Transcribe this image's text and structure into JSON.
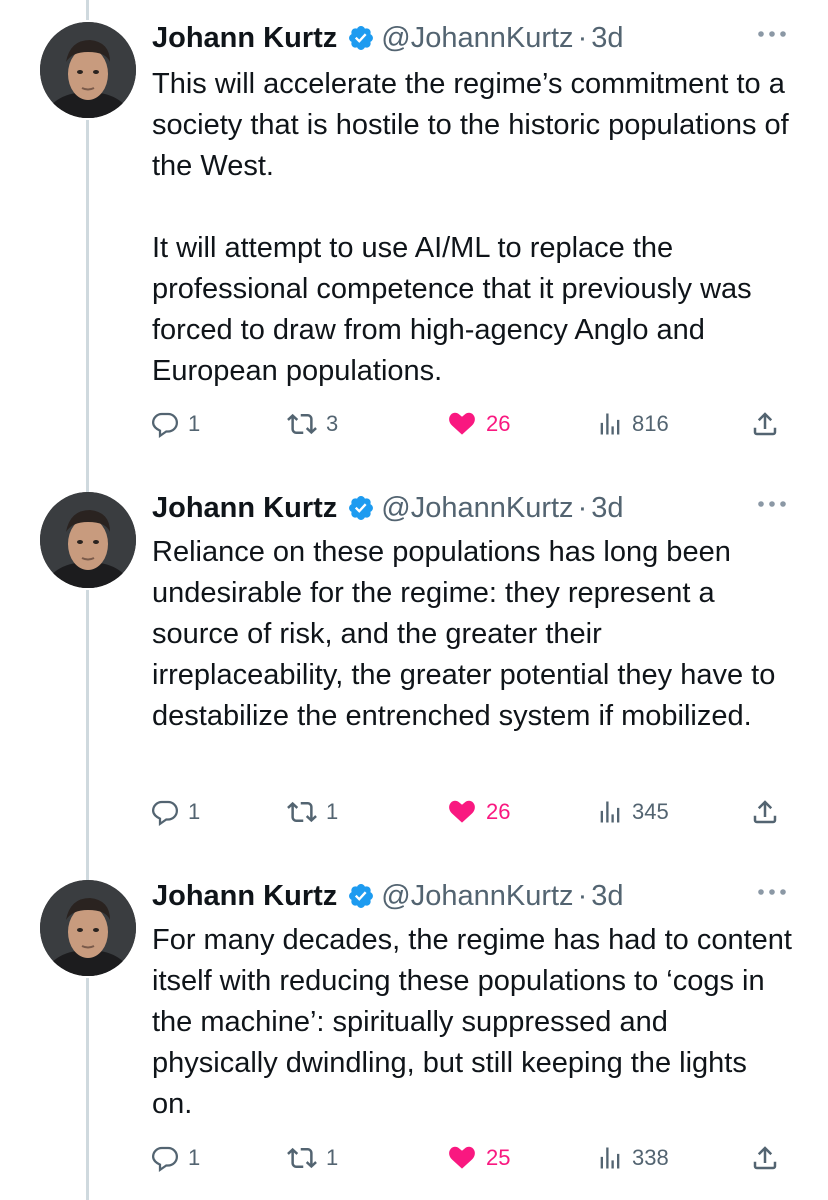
{
  "colors": {
    "text": "#0f1419",
    "secondary": "#536471",
    "verified": "#1d9bf0",
    "like": "#f91880",
    "thread_line": "#cfd9de"
  },
  "tweets": [
    {
      "author_name": "Johann Kurtz",
      "handle": "@JohannKurtz",
      "separator": "·",
      "time": "3d",
      "paragraphs": [
        "This will accelerate the regime’s commitment to a society that is hostile to the historic populations of the West.",
        "It will attempt to use AI/ML to replace the professional competence that it previously was forced to draw from high-agency Anglo and European populations."
      ],
      "replies": "1",
      "retweets": "3",
      "likes": "26",
      "views": "816",
      "liked": true
    },
    {
      "author_name": "Johann Kurtz",
      "handle": "@JohannKurtz",
      "separator": "·",
      "time": "3d",
      "paragraphs": [
        "Reliance on these populations has long been undesirable for the regime: they represent a source of risk, and the greater their irreplaceability, the greater potential they have to destabilize the entrenched system if mobilized."
      ],
      "replies": "1",
      "retweets": "1",
      "likes": "26",
      "views": "345",
      "liked": true
    },
    {
      "author_name": "Johann Kurtz",
      "handle": "@JohannKurtz",
      "separator": "·",
      "time": "3d",
      "paragraphs": [
        "For many decades, the regime has had to content itself with reducing these populations to ‘cogs in the machine’: spiritually suppressed and physically dwindling, but still keeping the lights on."
      ],
      "replies": "1",
      "retweets": "1",
      "likes": "25",
      "views": "338",
      "liked": true
    }
  ],
  "icons": {
    "avatar": "avatar-photo",
    "verified": "verified-badge-icon",
    "more": "more-options-icon",
    "reply": "reply-icon",
    "retweet": "retweet-icon",
    "like": "heart-icon",
    "views": "views-icon",
    "share": "share-icon"
  }
}
